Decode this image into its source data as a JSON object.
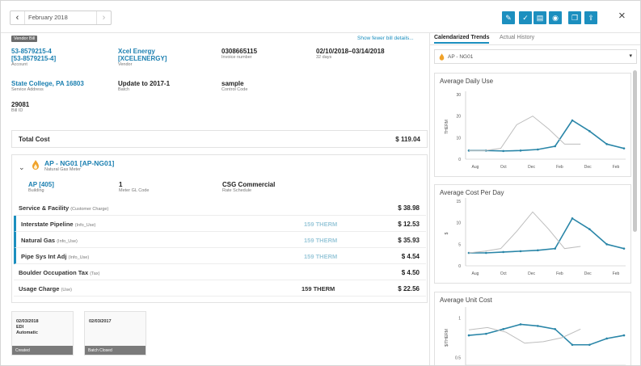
{
  "nav": {
    "date": "February 2018",
    "prev_icon": "chevron-left-icon",
    "next_icon": "chevron-right-icon"
  },
  "toolbar": {
    "buttons": [
      "edit-icon",
      "check-icon",
      "document-icon",
      "lock-icon",
      "copy-icon",
      "export-icon"
    ],
    "close": "×"
  },
  "badge": "Vendor Bill",
  "show_fewer": "Show fewer bill details...",
  "bill": {
    "account": "53-8579215-4\n[53-8579215-4]",
    "account_label": "Account",
    "vendor": "Xcel Energy\n[XCELENERGY]",
    "vendor_label": "Vendor",
    "invoice": "0308665115",
    "invoice_label": "Invoice number",
    "period": "02/10/2018–03/14/2018",
    "period_days": "32 days",
    "service_address": "State College, PA 16803",
    "service_address_label": "Service Address",
    "batch": "Update to 2017-1",
    "batch_label": "Batch",
    "control": "sample",
    "control_label": "Control Code",
    "bill_id": "29081",
    "bill_id_label": "Bill ID"
  },
  "total": {
    "label": "Total Cost",
    "amount": "$ 119.04"
  },
  "meter": {
    "name": "AP - NG01 [AP-NG01]",
    "type": "Natural Gas Meter",
    "building": "AP [405]",
    "building_label": "Building",
    "gl": "1",
    "gl_label": "Meter GL Code",
    "rate": "CSG Commercial",
    "rate_label": "Rate Schedule"
  },
  "charges": [
    {
      "name": "Service & Facility",
      "tag": "(Customer Charge)",
      "qty": "",
      "amount": "$ 38.98",
      "ind": false,
      "dark": false
    },
    {
      "name": "Interstate Pipeline",
      "tag": "(Info_Use)",
      "qty": "159 THERM",
      "amount": "$ 12.53",
      "ind": true,
      "dark": false
    },
    {
      "name": "Natural Gas",
      "tag": "(Info_Use)",
      "qty": "159 THERM",
      "amount": "$ 35.93",
      "ind": true,
      "dark": false
    },
    {
      "name": "Pipe Sys Int Adj",
      "tag": "(Info_Use)",
      "qty": "159 THERM",
      "amount": "$ 4.54",
      "ind": true,
      "dark": false
    },
    {
      "name": "Boulder Occupation Tax",
      "tag": "(Tax)",
      "qty": "",
      "amount": "$ 4.50",
      "ind": false,
      "dark": false
    },
    {
      "name": "Usage Charge",
      "tag": "(Use)",
      "qty": "159 THERM",
      "amount": "$ 22.56",
      "ind": false,
      "dark": true
    }
  ],
  "history": [
    {
      "date": "02/03/2018",
      "line2": "EDI",
      "line3": "Automatic",
      "status": "Created"
    },
    {
      "date": "02/03/2017",
      "line2": "",
      "line3": "",
      "status": "Batch Closed"
    }
  ],
  "tabs": {
    "active": "Calendarized Trends",
    "inactive": "Actual History"
  },
  "meter_select": "AP - NG01",
  "colors": {
    "accent": "#1c8fbf",
    "current": "#2a86a8",
    "prior": "#bdbdbd"
  },
  "chart_data": [
    {
      "type": "line",
      "title": "Average Daily Use",
      "ylabel": "THERM",
      "categories": [
        "Aug",
        "Oct",
        "Dec",
        "Feb",
        "Dec",
        "Feb"
      ],
      "yticks": [
        0,
        10,
        20,
        30
      ],
      "ylim": [
        0,
        30
      ],
      "series": [
        {
          "values": [
            4,
            4,
            3.8,
            4,
            4.5,
            6,
            18,
            13,
            7,
            5
          ]
        },
        {
          "values": [
            4,
            4,
            5,
            16,
            20,
            14,
            7,
            7
          ]
        }
      ]
    },
    {
      "type": "line",
      "title": "Average Cost Per Day",
      "ylabel": "$",
      "categories": [
        "Aug",
        "Oct",
        "Dec",
        "Feb",
        "Dec",
        "Feb"
      ],
      "yticks": [
        0,
        5,
        10,
        15
      ],
      "ylim": [
        0,
        15
      ],
      "series": [
        {
          "values": [
            3,
            3,
            3.2,
            3.4,
            3.6,
            4,
            11,
            8.5,
            5,
            4
          ]
        },
        {
          "values": [
            3,
            3.4,
            4,
            8,
            12.5,
            8.5,
            4,
            4.5
          ]
        }
      ]
    },
    {
      "type": "line",
      "title": "Average Unit Cost",
      "ylabel": "$/THERM",
      "yticks": [
        0.5,
        1.0
      ],
      "ylim": [
        0.4,
        1.1
      ],
      "series": [
        {
          "values": [
            0.78,
            0.8,
            0.86,
            0.92,
            0.9,
            0.86,
            0.66,
            0.66,
            0.74,
            0.78
          ]
        },
        {
          "values": [
            0.85,
            0.88,
            0.82,
            0.68,
            0.7,
            0.75,
            0.86
          ]
        }
      ]
    }
  ]
}
